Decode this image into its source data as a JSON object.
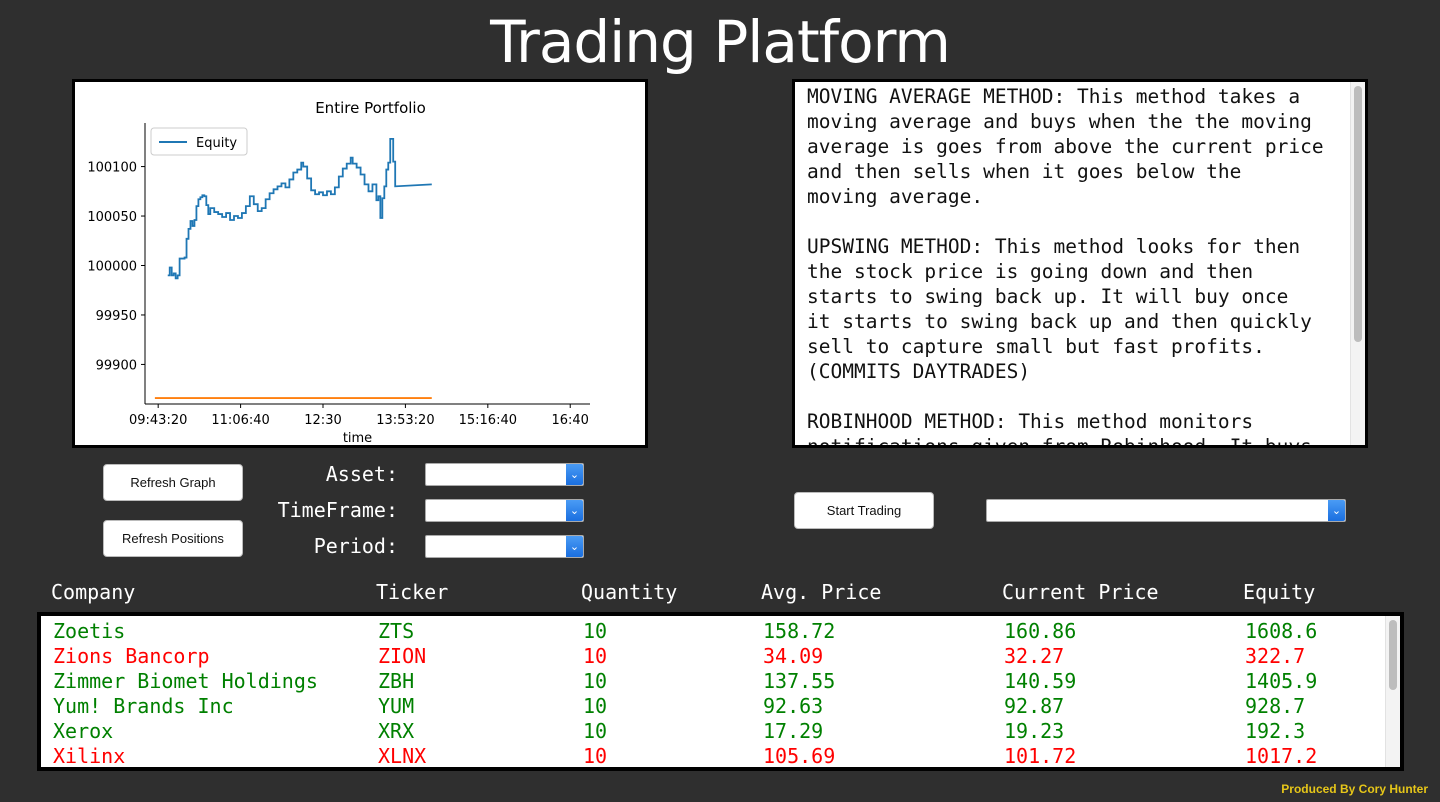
{
  "app": {
    "title": "Trading Platform",
    "footer": "Produced By Cory Hunter"
  },
  "chart_data": {
    "type": "line",
    "title": "Entire Portfolio",
    "xlabel": "time",
    "ylabel": "",
    "xticks": [
      "09:43:20",
      "11:06:40",
      "12:30",
      "13:53:20",
      "15:16:40",
      "16:40"
    ],
    "yticks": [
      "99900",
      "99950",
      "100000",
      "100050",
      "100100"
    ],
    "ylim": [
      99860,
      100140
    ],
    "xlim_minutes": [
      570,
      1020
    ],
    "legend": {
      "placement": "top-left",
      "entries": [
        "Equity"
      ]
    },
    "series": [
      {
        "name": "Equity",
        "color": "#1f77b4",
        "points": [
          [
            593,
            99990
          ],
          [
            595,
            99998
          ],
          [
            597,
            99990
          ],
          [
            599,
            99992
          ],
          [
            601,
            99987
          ],
          [
            603,
            99990
          ],
          [
            605,
            100007
          ],
          [
            607,
            100007
          ],
          [
            610,
            100008
          ],
          [
            612,
            100027
          ],
          [
            614,
            100037
          ],
          [
            616,
            100045
          ],
          [
            618,
            100040
          ],
          [
            620,
            100046
          ],
          [
            622,
            100060
          ],
          [
            624,
            100067
          ],
          [
            626,
            100069
          ],
          [
            628,
            100071
          ],
          [
            630,
            100070
          ],
          [
            632,
            100061
          ],
          [
            634,
            100052
          ],
          [
            636,
            100058
          ],
          [
            640,
            100054
          ],
          [
            644,
            100052
          ],
          [
            648,
            100049
          ],
          [
            652,
            100053
          ],
          [
            656,
            100046
          ],
          [
            660,
            100050
          ],
          [
            664,
            100048
          ],
          [
            668,
            100053
          ],
          [
            672,
            100060
          ],
          [
            676,
            100070
          ],
          [
            680,
            100062
          ],
          [
            684,
            100055
          ],
          [
            688,
            100058
          ],
          [
            692,
            100067
          ],
          [
            696,
            100073
          ],
          [
            700,
            100077
          ],
          [
            704,
            100080
          ],
          [
            708,
            100083
          ],
          [
            712,
            100079
          ],
          [
            716,
            100087
          ],
          [
            720,
            100094
          ],
          [
            724,
            100097
          ],
          [
            728,
            100104
          ],
          [
            730,
            100100
          ],
          [
            734,
            100088
          ],
          [
            738,
            100076
          ],
          [
            742,
            100072
          ],
          [
            746,
            100074
          ],
          [
            750,
            100071
          ],
          [
            754,
            100075
          ],
          [
            758,
            100072
          ],
          [
            762,
            100079
          ],
          [
            766,
            100090
          ],
          [
            770,
            100098
          ],
          [
            774,
            100103
          ],
          [
            778,
            100109
          ],
          [
            780,
            100103
          ],
          [
            784,
            100099
          ],
          [
            788,
            100092
          ],
          [
            792,
            100082
          ],
          [
            796,
            100075
          ],
          [
            800,
            100082
          ],
          [
            804,
            100066
          ],
          [
            806,
            100070
          ],
          [
            808,
            100048
          ],
          [
            810,
            100068
          ],
          [
            812,
            100080
          ],
          [
            814,
            100097
          ],
          [
            816,
            100104
          ],
          [
            818,
            100128
          ],
          [
            821,
            100105
          ],
          [
            823,
            100080
          ],
          [
            860,
            100082
          ]
        ]
      },
      {
        "name": "",
        "color": "#ff7f0e",
        "points": [
          [
            580,
            99866
          ],
          [
            860,
            99866
          ]
        ]
      }
    ]
  },
  "strategies": {
    "text": "MOVING AVERAGE METHOD: This method takes a\nmoving average and buys when the the moving\naverage is goes from above the current price\nand then sells when it goes below the\nmoving average.\n\nUPSWING METHOD: This method looks for then\nthe stock price is going down and then\nstarts to swing back up. It will buy once\nit starts to swing back up and then quickly\nsell to capture small but fast profits.\n(COMMITS DAYTRADES)\n\nROBINHOOD METHOD: This method monitors\nnotifications given from Robinhood. It buys"
  },
  "controls": {
    "refresh_graph": "Refresh Graph",
    "refresh_positions": "Refresh Positions",
    "asset_label": "Asset:",
    "timeframe_label": "TimeFrame:",
    "period_label": "Period:",
    "asset_value": "",
    "timeframe_value": "",
    "period_value": "",
    "start_trading": "Start Trading",
    "strategy_value": ""
  },
  "positions": {
    "headers": [
      "Company",
      "Ticker",
      "Quantity",
      "Avg. Price",
      "Current Price",
      "Equity"
    ],
    "gain_color": "#008000",
    "loss_color": "#ff0000",
    "rows": [
      {
        "status": "gain",
        "cells": [
          "Zoetis",
          "ZTS",
          "10",
          "158.72",
          "160.86",
          "1608.6"
        ]
      },
      {
        "status": "loss",
        "cells": [
          "Zions Bancorp",
          "ZION",
          "10",
          "34.09",
          "32.27",
          "322.7"
        ]
      },
      {
        "status": "gain",
        "cells": [
          "Zimmer Biomet Holdings",
          "ZBH",
          "10",
          "137.55",
          "140.59",
          "1405.9"
        ]
      },
      {
        "status": "gain",
        "cells": [
          "Yum! Brands Inc",
          "YUM",
          "10",
          "92.63",
          "92.87",
          "928.7"
        ]
      },
      {
        "status": "gain",
        "cells": [
          "Xerox",
          "XRX",
          "10",
          "17.29",
          "19.23",
          "192.3"
        ]
      },
      {
        "status": "loss",
        "cells": [
          "Xilinx",
          "XLNX",
          "10",
          "105.69",
          "101.72",
          "1017.2"
        ]
      }
    ]
  }
}
